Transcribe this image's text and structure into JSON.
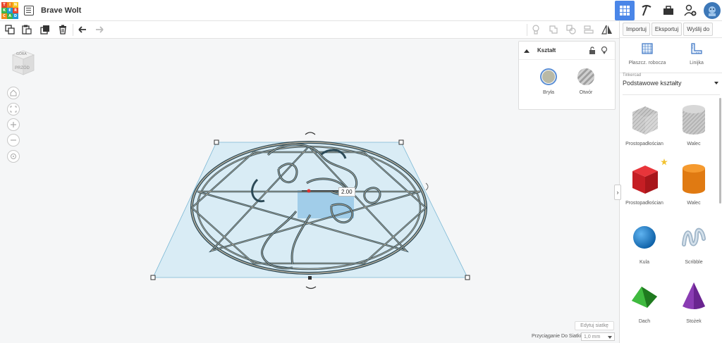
{
  "app": {
    "title": "Brave Wolt",
    "logo_letters": [
      "T",
      "I",
      "N",
      "K",
      "E",
      "R",
      "C",
      "A",
      "D"
    ],
    "logo_colors": [
      "#e8452c",
      "#f28b1a",
      "#f7c51e",
      "#3cb54a",
      "#1b9ad6",
      "#e8452c",
      "#f28b1a",
      "#3cb54a",
      "#1b9ad6"
    ]
  },
  "topright": {
    "views": [
      "grid-view-icon",
      "pickaxe-icon",
      "briefcase-icon",
      "add-user-icon"
    ],
    "active_color": "#4a86e8"
  },
  "toolbar": {
    "left_tools": [
      "copy-icon",
      "paste-icon",
      "duplicate-icon",
      "trash-icon",
      "undo-icon",
      "redo-icon"
    ],
    "right_tools": [
      "lightbulb-icon",
      "group-icon",
      "ungroup-icon",
      "align-icon",
      "mirror-icon"
    ]
  },
  "panel": {
    "buttons": [
      "Importuj",
      "Eksportuj",
      "Wyślij do"
    ],
    "workplane_label": "Płaszcz. robocza",
    "ruler_label": "Linijka",
    "library_small": "Tinkercad",
    "library_selected": "Podstawowe kształty",
    "shapes": [
      {
        "name": "Prostopadłościan",
        "kind": "box-gray",
        "favorite": false
      },
      {
        "name": "Walec",
        "kind": "cylinder-gray",
        "favorite": false
      },
      {
        "name": "Prostopadłościan",
        "kind": "box-red",
        "favorite": true
      },
      {
        "name": "Walec",
        "kind": "cylinder-orange",
        "favorite": false
      },
      {
        "name": "Kula",
        "kind": "sphere-blue",
        "favorite": false
      },
      {
        "name": "Scribble",
        "kind": "scribble",
        "favorite": false
      },
      {
        "name": "Dach",
        "kind": "roof-green",
        "favorite": false
      },
      {
        "name": "Stożek",
        "kind": "cone-purple",
        "favorite": false
      }
    ]
  },
  "inspector": {
    "title": "Kształt",
    "solid_label": "Bryła",
    "hole_label": "Otwór",
    "solid_color": "#b9b9a6"
  },
  "viewcube": {
    "top_label": "GÓRA",
    "front_label": "PRZÓD"
  },
  "canvas": {
    "dimension_label": "2.00"
  },
  "bottom": {
    "edit_grid": "Edytuj siatkę",
    "snap_label": "Przyciąganie Do Siatki",
    "snap_value": "1,0 mm"
  }
}
